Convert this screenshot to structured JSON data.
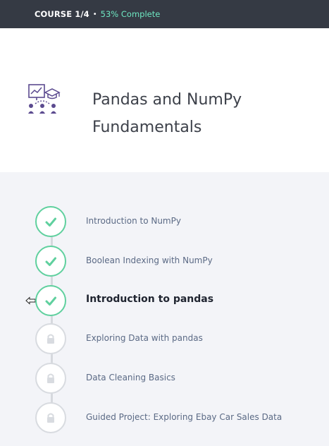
{
  "topbar": {
    "course_label": "COURSE 1/4",
    "separator": "•",
    "progress_label": "53% Complete",
    "progress_percent": 53
  },
  "header": {
    "title": "Pandas and NumPy Fundamentals",
    "icon": "data-science-course-icon"
  },
  "lessons": [
    {
      "label": "Introduction to NumPy",
      "status": "complete",
      "icon": "check-icon"
    },
    {
      "label": "Boolean Indexing with NumPy",
      "status": "complete",
      "icon": "check-icon"
    },
    {
      "label": "Introduction to pandas",
      "status": "complete",
      "icon": "check-icon",
      "current": true
    },
    {
      "label": "Exploring Data with pandas",
      "status": "locked",
      "icon": "lock-icon"
    },
    {
      "label": "Data Cleaning Basics",
      "status": "locked",
      "icon": "lock-icon"
    },
    {
      "label": "Guided Project: Exploring Ebay Car Sales Data",
      "status": "locked",
      "icon": "lock-icon"
    }
  ],
  "colors": {
    "topbar_bg": "#353a44",
    "progress_accent": "#6ee7c2",
    "complete_green": "#5fd09e",
    "locked_gray": "#d8dbe0",
    "page_bg": "#f3f4f8",
    "icon_purple": "#5b4a8f"
  }
}
